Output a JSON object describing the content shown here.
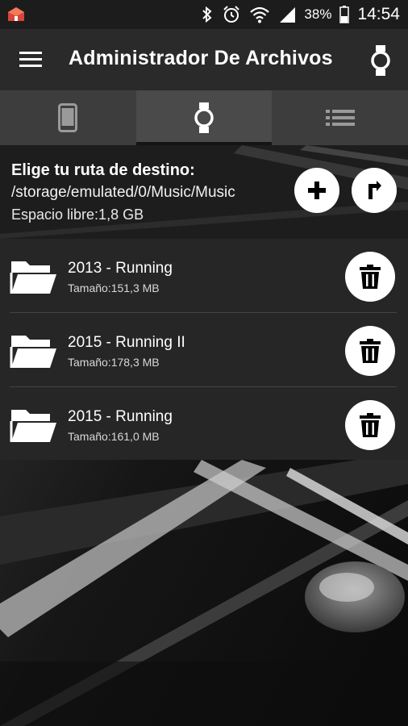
{
  "status_bar": {
    "battery_percent": "38%",
    "time": "14:54",
    "icons": [
      "app-notification-icon",
      "bluetooth-icon",
      "alarm-icon",
      "wifi-icon",
      "cell-signal-icon",
      "battery-icon"
    ]
  },
  "toolbar": {
    "title": "Administrador De Archivos",
    "menu_icon": "hamburger-menu-icon",
    "action_icon": "smartwatch-icon"
  },
  "tabs": [
    {
      "icon": "phone-icon",
      "selected": false
    },
    {
      "icon": "smartwatch-icon",
      "selected": true
    },
    {
      "icon": "list-icon",
      "selected": false
    }
  ],
  "destination": {
    "title": "Elige tu ruta de destino:",
    "path": "/storage/emulated/0/Music/Music",
    "free_space": "Espacio libre:1,8 GB",
    "add_icon": "plus-icon",
    "up_icon": "level-up-arrow-icon"
  },
  "folders": [
    {
      "name": "2013 - Running",
      "size": "Tamaño:151,3 MB"
    },
    {
      "name": "2015 - Running II",
      "size": "Tamaño:178,3 MB"
    },
    {
      "name": "2015 - Running",
      "size": "Tamaño:161,0 MB"
    }
  ],
  "colors": {
    "toolbar": "#2a2a2a",
    "tabs": "#3d3d3d",
    "list": "#262626",
    "button": "#ffffff"
  }
}
